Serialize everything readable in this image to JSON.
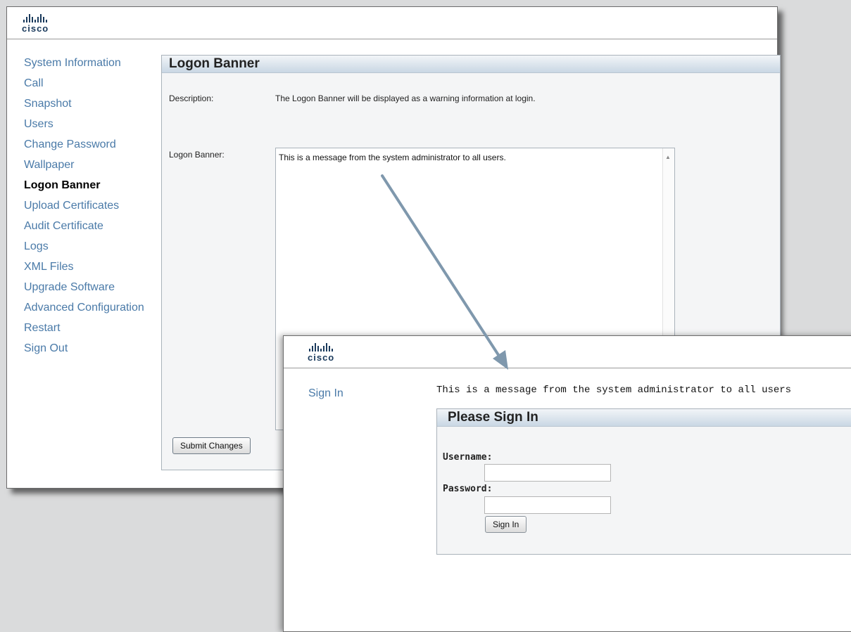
{
  "brand": {
    "logo_text": "cisco"
  },
  "admin": {
    "nav": [
      "System Information",
      "Call",
      "Snapshot",
      "Users",
      "Change Password",
      "Wallpaper",
      "Logon Banner",
      "Upload Certificates",
      "Audit Certificate",
      "Logs",
      "XML Files",
      "Upgrade Software",
      "Advanced Configuration",
      "Restart",
      "Sign Out"
    ],
    "active_nav": "Logon Banner",
    "panel_title": "Logon Banner",
    "description_label": "Description:",
    "description_text": "The Logon Banner will be displayed as a warning information at login.",
    "banner_label": "Logon Banner:",
    "banner_text": "This is a message from the system administrator to all users.",
    "submit_label": "Submit Changes"
  },
  "signin": {
    "nav_item": "Sign In",
    "banner_message": "This is a message from the system administrator to all users",
    "panel_title": "Please Sign In",
    "username_label": "Username:",
    "username_value": "",
    "password_label": "Password:",
    "password_value": "",
    "button_label": "Sign In"
  },
  "colors": {
    "link": "#4a7aa8",
    "arrow": "#7f98ad",
    "panel_header": "#c9d7e4"
  },
  "icons": [
    "cisco-logo",
    "scroll-up-arrow-icon",
    "callout-arrow"
  ]
}
